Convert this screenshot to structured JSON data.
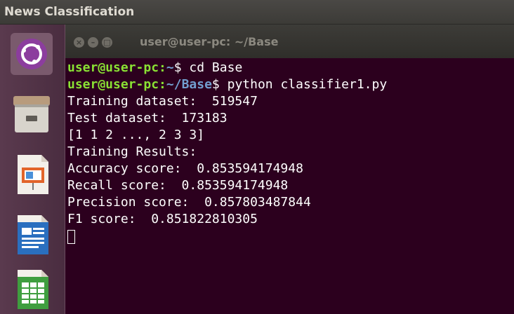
{
  "panel": {
    "title": "News Classification"
  },
  "launcher": {
    "items": [
      {
        "name": "dash-home-icon"
      },
      {
        "name": "file-manager-icon"
      },
      {
        "name": "libreoffice-impress-icon"
      },
      {
        "name": "libreoffice-writer-icon"
      },
      {
        "name": "libreoffice-calc-icon"
      }
    ]
  },
  "window": {
    "title": "user@user-pc: ~/Base",
    "buttons": {
      "close": "×",
      "minimize": "–",
      "maximize": "□"
    }
  },
  "terminal": {
    "prompt1": {
      "user": "user@user-pc",
      "sep": ":",
      "path": "~",
      "symbol": "$ ",
      "command": "cd Base"
    },
    "prompt2": {
      "user": "user@user-pc",
      "sep": ":",
      "path": "~/Base",
      "symbol": "$ ",
      "command": "python classifier1.py"
    },
    "output": [
      "Training dataset:  519547",
      "Test dataset:  173183",
      "[1 1 2 ..., 2 3 3]",
      "Training Results:",
      "Accuracy score:  0.853594174948",
      "Recall score:  0.853594174948",
      "Precision score:  0.857803487844",
      "F1 score:  0.851822810305"
    ]
  },
  "colors": {
    "terminal_bg": "#2c001e",
    "prompt_user": "#8ae234",
    "prompt_path": "#729fcf",
    "text": "#ffffff"
  }
}
